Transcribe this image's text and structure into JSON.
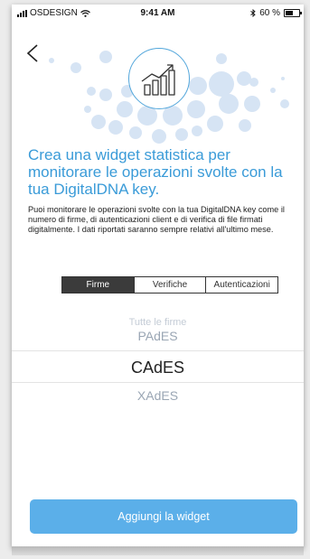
{
  "status_bar": {
    "carrier": "OSDESIGN",
    "time": "9:41 AM",
    "battery": "60 %"
  },
  "icons": {
    "back": "chevron-left-icon",
    "hero": "chart-growth-icon",
    "wifi": "wifi-icon",
    "bluetooth": "bluetooth-icon",
    "battery": "battery-icon",
    "signal": "signal-icon"
  },
  "colors": {
    "accent": "#3a9bd8",
    "button": "#5bafe9",
    "segment_active": "#3b3b3b"
  },
  "headline": "Crea una widget statistica per monitorare le operazioni svolte con la tua DigitalDNA key.",
  "description": "Puoi monitorare le operazioni svolte con la tua DigitalDNA key come il numero di firme, di autenticazioni client e di verifica di file firmati digitalmente. I dati riportati saranno sempre relativi all'ultimo mese.",
  "tabs": [
    {
      "label": "Firme",
      "active": true
    },
    {
      "label": "Verifiche",
      "active": false
    },
    {
      "label": "Autenticazioni",
      "active": false
    }
  ],
  "picker": {
    "options": [
      "Tutte le firme",
      "PAdES",
      "CAdES",
      "XAdES"
    ],
    "selected": "CAdES"
  },
  "button": {
    "label": "Aggiungi la widget"
  }
}
